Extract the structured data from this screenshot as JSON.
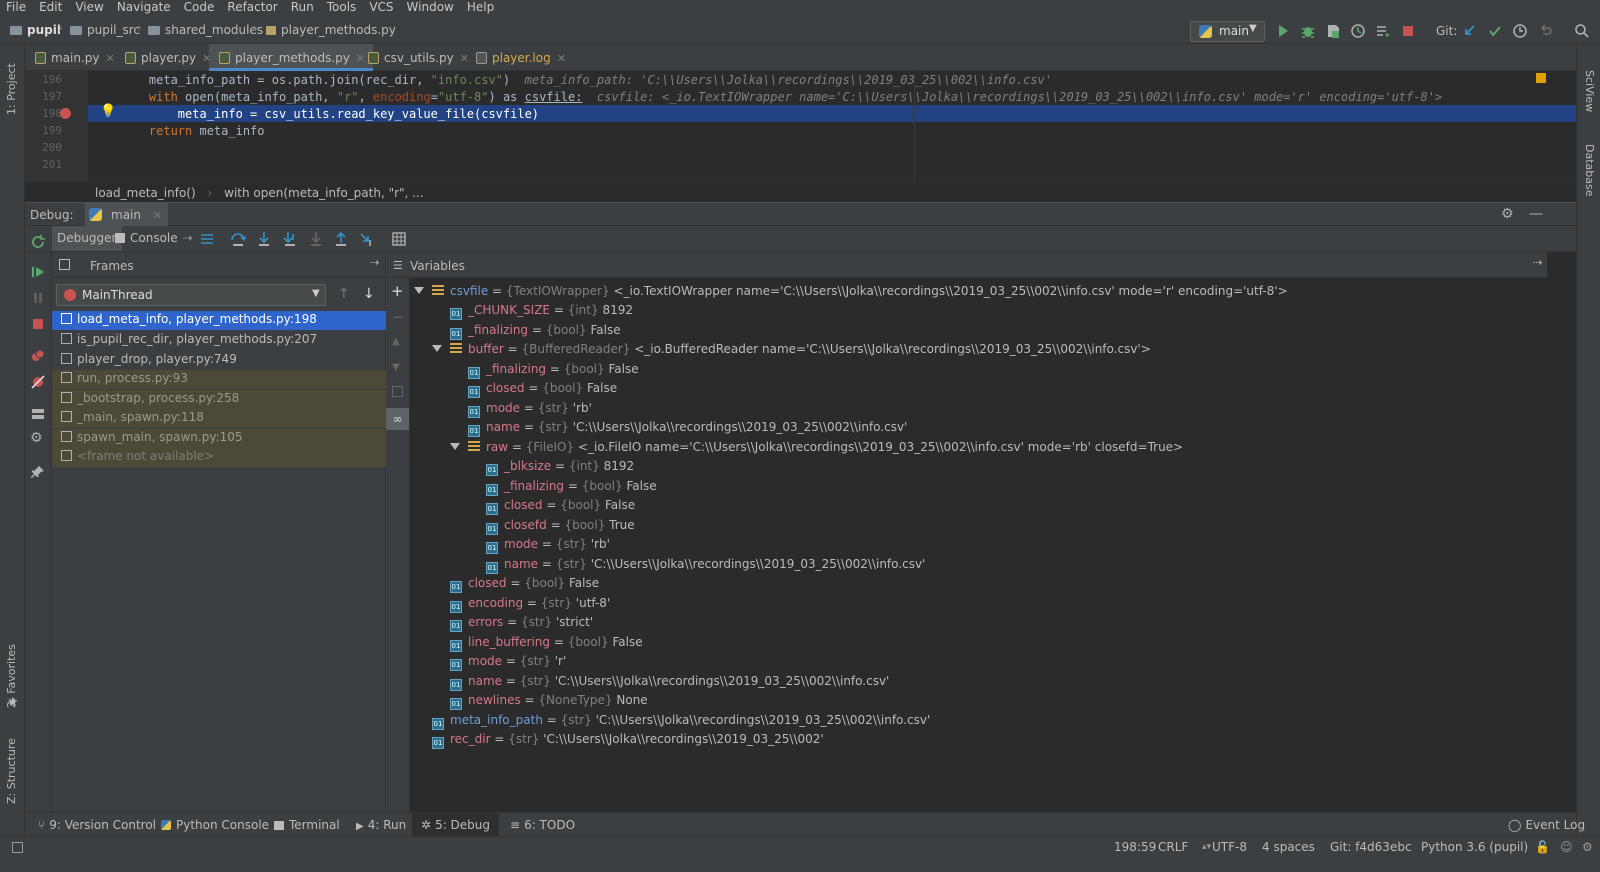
{
  "menu": [
    "File",
    "Edit",
    "View",
    "Navigate",
    "Code",
    "Refactor",
    "Run",
    "Tools",
    "VCS",
    "Window",
    "Help"
  ],
  "breadcrumb": [
    "pupil",
    "pupil_src",
    "shared_modules",
    "player_methods.py"
  ],
  "run_config": "main",
  "git_label": "Git:",
  "tabs": [
    {
      "label": "main.py"
    },
    {
      "label": "player.py"
    },
    {
      "label": "player_methods.py"
    },
    {
      "label": "csv_utils.py"
    },
    {
      "label": "player.log"
    }
  ],
  "editor": {
    "line_numbers": [
      "196",
      "197",
      "198",
      "199",
      "200",
      "201"
    ],
    "l196_code": "    meta_info_path = os.path.join(rec_dir, ",
    "l196_str": "\"info.csv\"",
    "l196_close": ")",
    "l196_hint": "  meta_info_path: 'C:\\\\Users\\\\Jolka\\\\recordings\\\\2019_03_25\\\\002\\\\info.csv'",
    "l197_kw": "    with ",
    "l197_code": "open(meta_info_path, ",
    "l197_str": "\"r\"",
    "l197_comma": ", ",
    "l197_param": "encoding",
    "l197_eq": "=",
    "l197_str2": "\"utf-8\"",
    "l197_as": ") as ",
    "l197_var": "csvfile:",
    "l197_hint": "  csvfile: <_io.TextIOWrapper name='C:\\\\Users\\\\Jolka\\\\recordings\\\\2019_03_25\\\\002\\\\info.csv' mode='r' encoding='utf-8'>",
    "l198_code": "        meta_info = csv_utils.read_key_value_file(csvfile)",
    "l199_kw": "    return ",
    "l199_code": "meta_info"
  },
  "editor_breadcrumb": [
    "load_meta_info()",
    "with open(meta_info_path, \"r\", ..."
  ],
  "debug": {
    "label": "Debug:",
    "config": "main",
    "debugger_tab": "Debugger",
    "console_tab": "Console",
    "frames_title": "Frames",
    "variables_title": "Variables",
    "thread": "MainThread"
  },
  "frames": [
    "load_meta_info, player_methods.py:198",
    "is_pupil_rec_dir, player_methods.py:207",
    "player_drop, player.py:749",
    "run, process.py:93",
    "_bootstrap, process.py:258",
    "_main, spawn.py:118",
    "spawn_main, spawn.py:105",
    "<frame not available>"
  ],
  "variables": [
    {
      "name": "csvfile",
      "type": "{TextIOWrapper}",
      "value": "<_io.TextIOWrapper name='C:\\\\Users\\\\Jolka\\\\recordings\\\\2019_03_25\\\\002\\\\info.csv' mode='r' encoding='utf-8'>"
    },
    {
      "name": "_CHUNK_SIZE",
      "type": "{int}",
      "value": "8192"
    },
    {
      "name": "_finalizing",
      "type": "{bool}",
      "value": "False"
    },
    {
      "name": "buffer",
      "type": "{BufferedReader}",
      "value": "<_io.BufferedReader name='C:\\\\Users\\\\Jolka\\\\recordings\\\\2019_03_25\\\\002\\\\info.csv'>"
    },
    {
      "name": "_finalizing",
      "type": "{bool}",
      "value": "False"
    },
    {
      "name": "closed",
      "type": "{bool}",
      "value": "False"
    },
    {
      "name": "mode",
      "type": "{str}",
      "value": "'rb'"
    },
    {
      "name": "name",
      "type": "{str}",
      "value": "'C:\\\\Users\\\\Jolka\\\\recordings\\\\2019_03_25\\\\002\\\\info.csv'"
    },
    {
      "name": "raw",
      "type": "{FileIO}",
      "value": "<_io.FileIO name='C:\\\\Users\\\\Jolka\\\\recordings\\\\2019_03_25\\\\002\\\\info.csv' mode='rb' closefd=True>"
    },
    {
      "name": "_blksize",
      "type": "{int}",
      "value": "8192"
    },
    {
      "name": "_finalizing",
      "type": "{bool}",
      "value": "False"
    },
    {
      "name": "closed",
      "type": "{bool}",
      "value": "False"
    },
    {
      "name": "closefd",
      "type": "{bool}",
      "value": "True"
    },
    {
      "name": "mode",
      "type": "{str}",
      "value": "'rb'"
    },
    {
      "name": "name",
      "type": "{str}",
      "value": "'C:\\\\Users\\\\Jolka\\\\recordings\\\\2019_03_25\\\\002\\\\info.csv'"
    },
    {
      "name": "closed",
      "type": "{bool}",
      "value": "False"
    },
    {
      "name": "encoding",
      "type": "{str}",
      "value": "'utf-8'"
    },
    {
      "name": "errors",
      "type": "{str}",
      "value": "'strict'"
    },
    {
      "name": "line_buffering",
      "type": "{bool}",
      "value": "False"
    },
    {
      "name": "mode",
      "type": "{str}",
      "value": "'r'"
    },
    {
      "name": "name",
      "type": "{str}",
      "value": "'C:\\\\Users\\\\Jolka\\\\recordings\\\\2019_03_25\\\\002\\\\info.csv'"
    },
    {
      "name": "newlines",
      "type": "{NoneType}",
      "value": "None"
    },
    {
      "name": "meta_info_path",
      "type": "{str}",
      "value": "'C:\\\\Users\\\\Jolka\\\\recordings\\\\2019_03_25\\\\002\\\\info.csv'"
    },
    {
      "name": "rec_dir",
      "type": "{str}",
      "value": "'C:\\\\Users\\\\Jolka\\\\recordings\\\\2019_03_25\\\\002'"
    }
  ],
  "tool_windows": {
    "left_top": "1: Project",
    "left_favorites": "2: Favorites",
    "left_structure": "Z: Structure",
    "right_sciview": "SciView",
    "right_database": "Database"
  },
  "bottom_tabs": [
    "9: Version Control",
    "Python Console",
    "Terminal",
    "4: Run",
    "5: Debug",
    "6: TODO"
  ],
  "event_log": "Event Log",
  "status": {
    "position": "198:59",
    "line_sep": "CRLF",
    "encoding": "UTF-8",
    "indent": "4 spaces",
    "git": "Git: f4d63ebc",
    "interpreter": "Python 3.6 (pupil)"
  },
  "colors": {
    "accent": "#4a88c7",
    "selection": "#2f65ca",
    "current_line": "#214283",
    "breakpoint": "#c75450",
    "run_green": "#59a869"
  }
}
